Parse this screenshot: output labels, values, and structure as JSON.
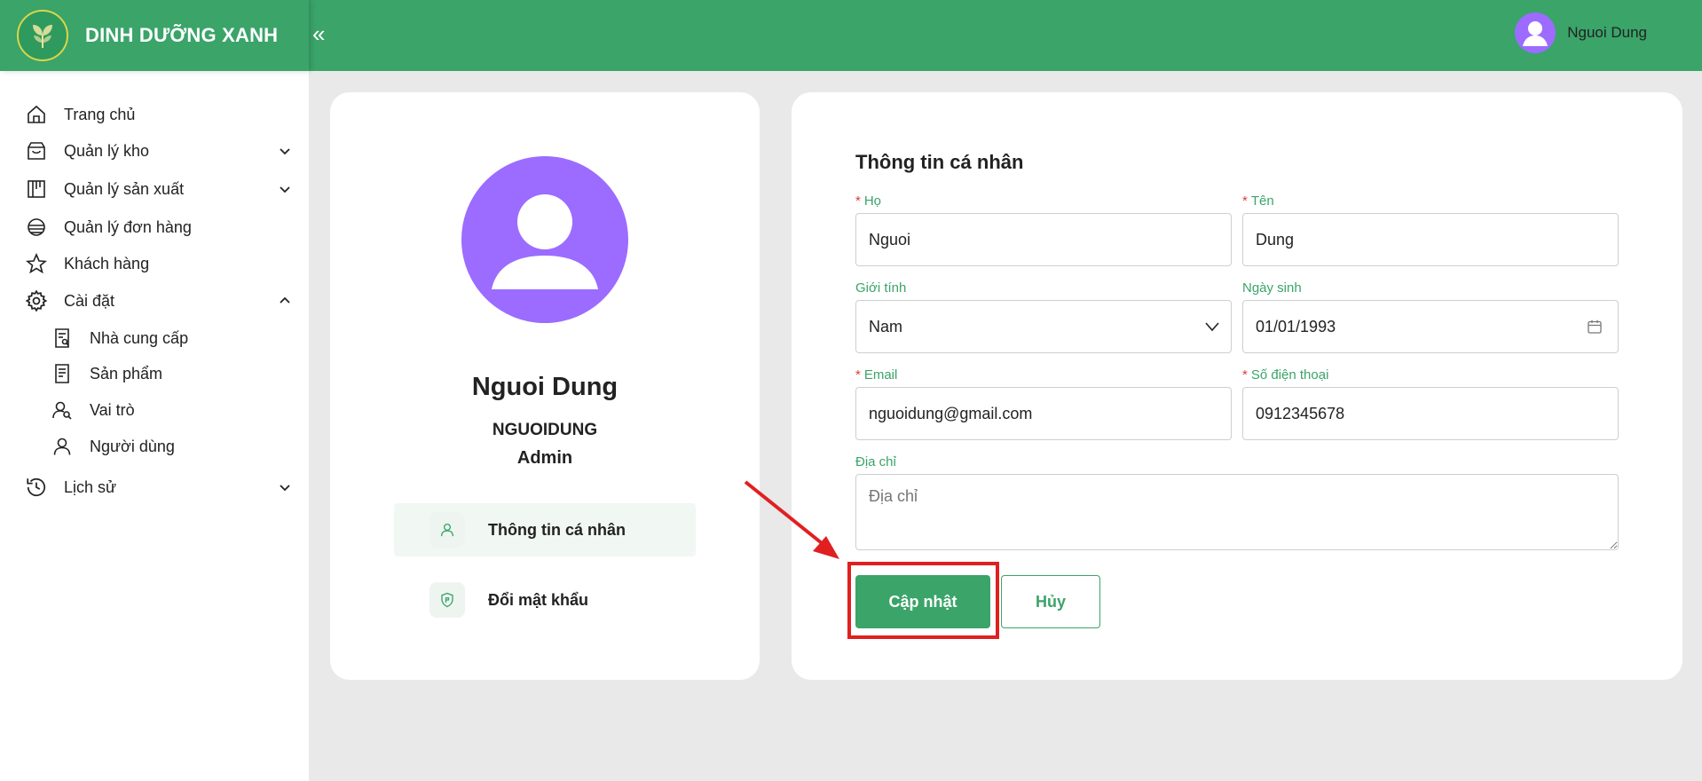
{
  "app": {
    "brand_name": "DINH DƯỠNG XANH",
    "collapse_glyph": "«"
  },
  "header": {
    "user_name": "Nguoi Dung"
  },
  "sidebar": {
    "items": [
      {
        "label": "Trang chủ",
        "icon": "home-icon"
      },
      {
        "label": "Quản lý kho",
        "icon": "inventory-icon",
        "expandable": true
      },
      {
        "label": "Quản lý sản xuất",
        "icon": "production-icon",
        "expandable": true
      },
      {
        "label": "Quản lý đơn hàng",
        "icon": "orders-icon"
      },
      {
        "label": "Khách hàng",
        "icon": "star-icon"
      },
      {
        "label": "Cài đặt",
        "icon": "settings-icon",
        "expanded": true
      },
      {
        "label": "Nhà cung cấp",
        "icon": "supplier-icon"
      },
      {
        "label": "Sản phẩm",
        "icon": "product-icon"
      },
      {
        "label": "Vai trò",
        "icon": "roles-icon"
      },
      {
        "label": "Người dùng",
        "icon": "user-icon"
      },
      {
        "label": "Lịch sử",
        "icon": "history-icon",
        "expandable": true
      }
    ]
  },
  "profile": {
    "full_name": "Nguoi Dung",
    "username": "NGUOIDUNG",
    "role": "Admin",
    "menu": [
      {
        "label": "Thông tin cá nhân",
        "icon": "user-icon",
        "active": true
      },
      {
        "label": "Đổi mật khẩu",
        "icon": "shield-icon",
        "active": false
      }
    ]
  },
  "form": {
    "title": "Thông tin cá nhân",
    "required_mark": "*",
    "last_name": {
      "label": "Họ",
      "value": "Nguoi",
      "required": true
    },
    "first_name": {
      "label": "Tên",
      "value": "Dung",
      "required": true
    },
    "gender": {
      "label": "Giới tính",
      "value": "Nam"
    },
    "birthday": {
      "label": "Ngày sinh",
      "value": "01/01/1993"
    },
    "email": {
      "label": "Email",
      "value": "nguoidung@gmail.com",
      "required": true
    },
    "phone": {
      "label": "Số điện thoại",
      "value": "0912345678",
      "required": true
    },
    "address": {
      "label": "Địa chỉ",
      "placeholder": "Địa chỉ",
      "value": ""
    },
    "submit_label": "Cập nhật",
    "cancel_label": "Hủy"
  },
  "colors": {
    "primary": "#3aa469",
    "avatar": "#9b6cff",
    "annotation": "#e02020"
  }
}
